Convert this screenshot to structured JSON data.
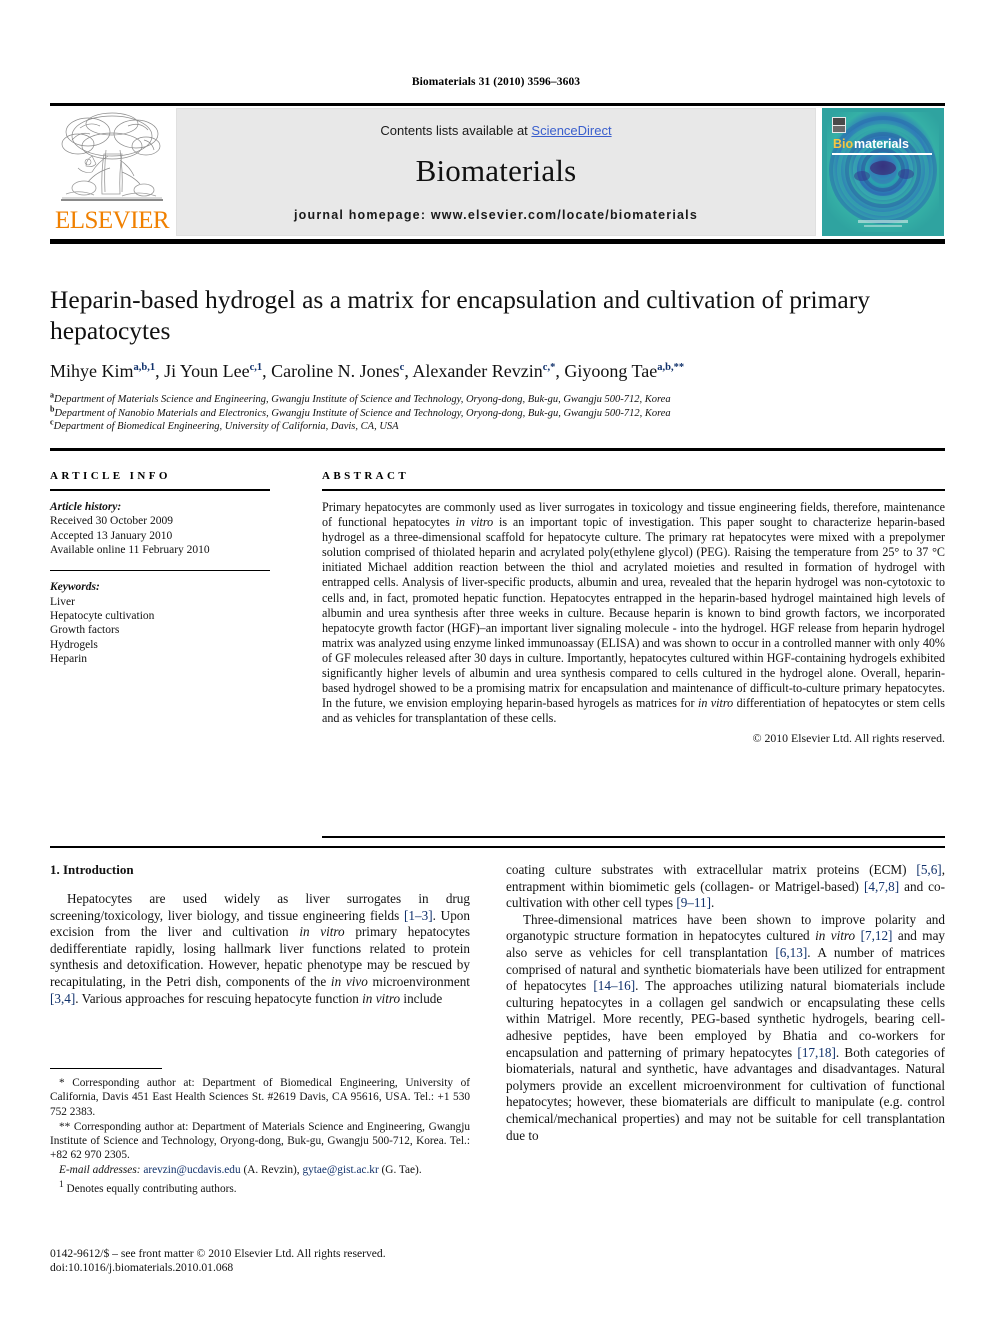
{
  "running_head": "Biomaterials 31 (2010) 3596–3603",
  "masthead": {
    "contents_prefix": "Contents lists available at ",
    "sciencedirect": "ScienceDirect",
    "journal_title": "Biomaterials",
    "homepage": "journal homepage: www.elsevier.com/locate/biomaterials",
    "publisher_wordmark": "ELSEVIER",
    "publisher_color": "#F08000",
    "link_color": "#3a5fcd",
    "cover_title_prefix": "Bio",
    "cover_title_rest": "materials",
    "cover_bg": "#1f8f93"
  },
  "title": "Heparin-based hydrogel as a matrix for encapsulation and cultivation of primary hepatocytes",
  "authors": [
    {
      "name": "Mihye Kim",
      "sup": "a,b,1",
      "sep": ", "
    },
    {
      "name": "Ji Youn Lee",
      "sup": "c,1",
      "sep": ", "
    },
    {
      "name": "Caroline N. Jones",
      "sup": "c",
      "sep": ", "
    },
    {
      "name": "Alexander Revzin",
      "sup": "c,*",
      "sep": ", "
    },
    {
      "name": "Giyoong Tae",
      "sup": "a,b,**",
      "sep": ""
    }
  ],
  "affiliations": [
    {
      "mark": "a",
      "text": "Department of Materials Science and Engineering, Gwangju Institute of Science and Technology, Oryong-dong, Buk-gu, Gwangju 500-712, Korea"
    },
    {
      "mark": "b",
      "text": "Department of Nanobio Materials and Electronics, Gwangju Institute of Science and Technology, Oryong-dong, Buk-gu, Gwangju 500-712, Korea"
    },
    {
      "mark": "c",
      "text": "Department of Biomedical Engineering, University of California, Davis, CA, USA"
    }
  ],
  "article_info": {
    "heading": "ARTICLE INFO",
    "history_label": "Article history:",
    "history": [
      "Received 30 October 2009",
      "Accepted 13 January 2010",
      "Available online 11 February 2010"
    ],
    "keywords_label": "Keywords:",
    "keywords": [
      "Liver",
      "Hepatocyte cultivation",
      "Growth factors",
      "Hydrogels",
      "Heparin"
    ]
  },
  "abstract": {
    "heading": "ABSTRACT",
    "paragraph_html": "Primary hepatocytes are commonly used as liver surrogates in toxicology and tissue engineering fields, therefore, maintenance of functional hepatocytes <i>in vitro</i> is an important topic of investigation. This paper sought to characterize heparin-based hydrogel as a three-dimensional scaffold for hepatocyte culture. The primary rat hepatocytes were mixed with a prepolymer solution comprised of thiolated heparin and acrylated poly(ethylene glycol) (PEG). Raising the temperature from 25° to 37 °C initiated Michael addition reaction between the thiol and acrylated moieties and resulted in formation of hydrogel with entrapped cells. Analysis of liver-specific products, albumin and urea, revealed that the heparin hydrogel was non-cytotoxic to cells and, in fact, promoted hepatic function. Hepatocytes entrapped in the heparin-based hydrogel maintained high levels of albumin and urea synthesis after three weeks in culture. Because heparin is known to bind growth factors, we incorporated hepatocyte growth factor (HGF)–an important liver signaling molecule - into the hydrogel. HGF release from heparin hydrogel matrix was analyzed using enzyme linked immunoassay (ELISA) and was shown to occur in a controlled manner with only 40% of GF molecules released after 30 days in culture. Importantly, hepatocytes cultured within HGF-containing hydrogels exhibited significantly higher levels of albumin and urea synthesis compared to cells cultured in the hydrogel alone. Overall, heparin-based hydrogel showed to be a promising matrix for encapsulation and maintenance of difficult-to-culture primary hepatocytes. In the future, we envision employing heparin-based hyrogels as matrices for <i>in vitro</i> differentiation of hepatocytes or stem cells and as vehicles for transplantation of these cells.",
    "copyright": "© 2010 Elsevier Ltd. All rights reserved."
  },
  "body": {
    "section_heading": "1. Introduction",
    "left_paragraph_html": "Hepatocytes are used widely as liver surrogates in drug screening/toxicology, liver biology, and tissue engineering fields <span class=\"ref\">[1–3]</span>. Upon excision from the liver and cultivation <i>in vitro</i> primary hepatocytes dedifferentiate rapidly, losing hallmark liver functions related to protein synthesis and detoxification. However, hepatic phenotype may be rescued by recapitulating, in the Petri dish, components of the <i>in vivo</i> microenvironment <span class=\"ref\">[3,4]</span>. Various approaches for rescuing hepatocyte function <i>in vitro</i> include",
    "right_paragraph_1_html": "coating culture substrates with extracellular matrix proteins (ECM) <span class=\"ref\">[5,6]</span>, entrapment within biomimetic gels (collagen- or Matrigel-based) <span class=\"ref\">[4,7,8]</span> and co-cultivation with other cell types <span class=\"ref\">[9–11]</span>.",
    "right_paragraph_2_html": "Three-dimensional matrices have been shown to improve polarity and organotypic structure formation in hepatocytes cultured <i>in vitro</i> <span class=\"ref\">[7,12]</span> and may also serve as vehicles for cell transplantation <span class=\"ref\">[6,13]</span>. A number of matrices comprised of natural and synthetic biomaterials have been utilized for entrapment of hepatocytes <span class=\"ref\">[14–16]</span>. The approaches utilizing natural biomaterials include culturing hepatocytes in a collagen gel sandwich or encapsulating these cells within Matrigel. More recently, PEG-based synthetic hydrogels, bearing cell-adhesive peptides, have been employed by Bhatia and co-workers for encapsulation and patterning of primary hepatocytes <span class=\"ref\">[17,18]</span>. Both categories of biomaterials, natural and synthetic, have advantages and disadvantages. Natural polymers provide an excellent microenvironment for cultivation of functional hepatocytes; however, these biomaterials are difficult to manipulate (e.g. control chemical/mechanical properties) and may not be suitable for cell transplantation due to"
  },
  "footnotes": {
    "corresponding_1_html": "<span class=\"mark\">*</span> Corresponding author at: Department of Biomedical Engineering, University of California, Davis 451 East Health Sciences St. #2619 Davis, CA 95616, USA. Tel.: +1 530 752 2383.",
    "corresponding_2_html": "<span class=\"mark\">**</span> Corresponding author at: Department of Materials Science and Engineering, Gwangju Institute of Science and Technology, Oryong-dong, Buk-gu, Gwangju 500-712, Korea. Tel.: +82 62 970 2305.",
    "email_label": "E-mail addresses:",
    "email_1": "arevzin@ucdavis.edu",
    "email_1_who": "(A. Revzin)",
    "email_2": "gytae@gist.ac.kr",
    "email_2_who": "(G. Tae)",
    "equal_contrib_mark": "1",
    "equal_contrib": "Denotes equally contributing authors."
  },
  "imprint": {
    "line1": "0142-9612/$ – see front matter © 2010 Elsevier Ltd. All rights reserved.",
    "line2": "doi:10.1016/j.biomaterials.2010.01.068"
  }
}
